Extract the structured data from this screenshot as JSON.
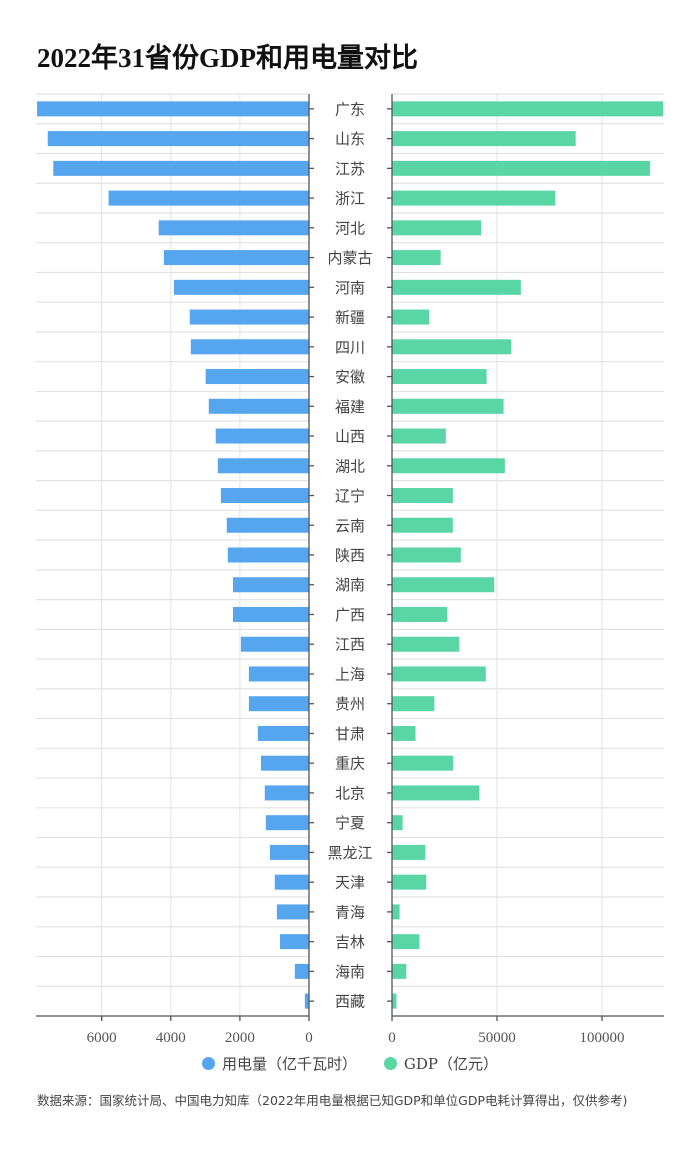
{
  "title": "2022年31省份GDP和用电量对比",
  "footer": "数据来源：国家统计局、中国电力知库（2022年用电量根据已知GDP和单位GDP电耗计算得出，仅供参考)",
  "colors": {
    "electricity": "#55a5ef",
    "gdp": "#5ad6a6",
    "grid": "#e2e2e2",
    "axis": "#555555"
  },
  "chart_data": {
    "type": "bar",
    "orientation": "horizontal",
    "layout": "butterfly",
    "title": "2022年31省份GDP和用电量对比",
    "categories": [
      "广东",
      "山东",
      "江苏",
      "浙江",
      "河北",
      "内蒙古",
      "河南",
      "新疆",
      "四川",
      "安徽",
      "福建",
      "山西",
      "湖北",
      "辽宁",
      "云南",
      "陕西",
      "湖南",
      "广西",
      "江西",
      "上海",
      "贵州",
      "甘肃",
      "重庆",
      "北京",
      "宁夏",
      "黑龙江",
      "天津",
      "青海",
      "吉林",
      "海南",
      "西藏"
    ],
    "series": [
      {
        "name": "用电量（亿千瓦时）",
        "side": "left",
        "color": "#55a5ef",
        "values": [
          7870,
          7560,
          7400,
          5800,
          4350,
          4200,
          3910,
          3450,
          3420,
          2990,
          2900,
          2700,
          2640,
          2550,
          2380,
          2350,
          2200,
          2200,
          1970,
          1740,
          1740,
          1480,
          1390,
          1280,
          1250,
          1130,
          990,
          930,
          840,
          410,
          120
        ],
        "xlim": [
          0,
          7900
        ],
        "ticks": [
          0,
          2000,
          4000,
          6000
        ],
        "tick_labels": [
          "0",
          "2000",
          "4000",
          "6000"
        ]
      },
      {
        "name": "GDP（亿元）",
        "side": "right",
        "color": "#5ad6a6",
        "values": [
          129118,
          87435,
          122876,
          77715,
          42370,
          23159,
          61345,
          17741,
          56750,
          45045,
          53110,
          25643,
          53735,
          28975,
          28954,
          32773,
          48670,
          26301,
          32075,
          44653,
          20165,
          11202,
          29129,
          41611,
          5070,
          15901,
          16311,
          3610,
          13070,
          6818,
          2133
        ],
        "xlim": [
          0,
          129500
        ],
        "ticks": [
          0,
          50000,
          100000
        ],
        "tick_labels": [
          "0",
          "50000",
          "100000"
        ]
      }
    ],
    "legend": {
      "position": "bottom-center",
      "entries": [
        "用电量（亿千瓦时）",
        "GDP（亿元）"
      ]
    },
    "grid": true
  }
}
